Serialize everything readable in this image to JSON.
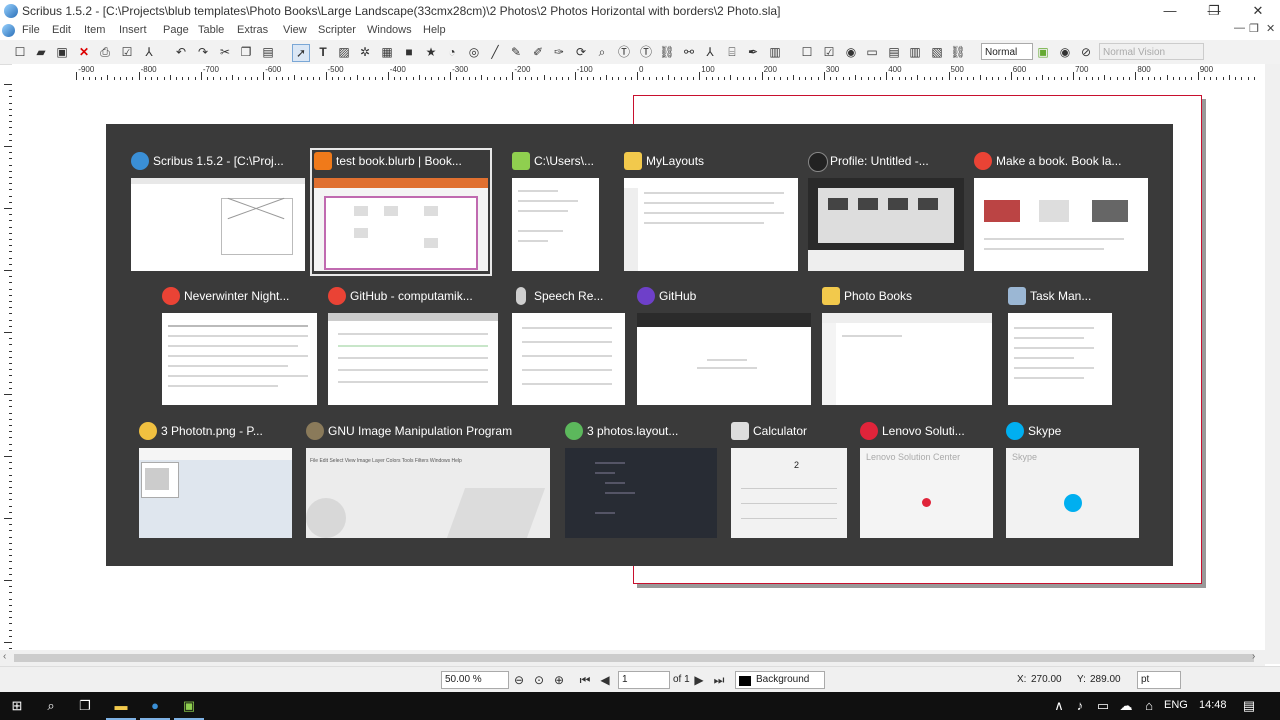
{
  "window": {
    "title": "Scribus 1.5.2 - [C:\\Projects\\blub templates\\Photo Books\\Large Landscape(33cmx28cm)\\2 Photos\\2 Photos Horizontal with borders\\2 Photo.sla]",
    "controls": {
      "minimize": "—",
      "restore": "❐",
      "close": "✕"
    },
    "inner_controls": {
      "minimize": "—",
      "restore": "❐",
      "close": "✕"
    }
  },
  "menu": [
    "File",
    "Edit",
    "Item",
    "Insert",
    "Page",
    "Table",
    "Extras",
    "View",
    "Scripter",
    "Windows",
    "Help"
  ],
  "toolbar": {
    "mode_select": "Normal",
    "vision_select": "Normal Vision"
  },
  "ruler_labels": [
    "-900",
    "-800",
    "-700",
    "-600",
    "-500",
    "-400",
    "-300",
    "-200",
    "-100",
    "0",
    "100",
    "200",
    "300",
    "400",
    "500",
    "600",
    "700",
    "800",
    "900"
  ],
  "task_switcher": {
    "rows": [
      [
        {
          "label": "Scribus 1.5.2 - [C:\\Proj...",
          "icon": "scribus-icon",
          "color": "#3a8fd6"
        },
        {
          "label": "test book.blurb | Book...",
          "icon": "booksmart-icon",
          "color": "#f07a1a",
          "selected": true
        },
        {
          "label": "C:\\Users\\...",
          "icon": "notepadpp-icon",
          "color": "#8fcf4f"
        },
        {
          "label": "MyLayouts",
          "icon": "folder-icon",
          "color": "#f2c94c"
        },
        {
          "label": "Profile: Untitled -...",
          "icon": "obs-icon",
          "color": "#222222"
        },
        {
          "label": "Make a book. Book la...",
          "icon": "chrome-icon",
          "color": "#ea4335"
        }
      ],
      [
        {
          "label": "Neverwinter Night...",
          "icon": "chrome-icon",
          "color": "#ea4335"
        },
        {
          "label": "GitHub - computamik...",
          "icon": "chrome-icon",
          "color": "#ea4335"
        },
        {
          "label": "Speech Re...",
          "icon": "microphone-icon",
          "color": "#cfcfcf"
        },
        {
          "label": "GitHub",
          "icon": "github-icon",
          "color": "#6e40c9"
        },
        {
          "label": "Photo Books",
          "icon": "folder-icon",
          "color": "#f2c94c"
        },
        {
          "label": "Task Man...",
          "icon": "task-manager-icon",
          "color": "#9bb7d4"
        }
      ],
      [
        {
          "label": "3 Phototn.png - P...",
          "icon": "paint-icon",
          "color": "#f0c040"
        },
        {
          "label": "GNU Image Manipulation Program",
          "icon": "gimp-icon",
          "color": "#8a7a5a"
        },
        {
          "label": "3 photos.layout...",
          "icon": "atom-icon",
          "color": "#5cb85c"
        },
        {
          "label": "Calculator",
          "icon": "calculator-icon",
          "color": "#dddddd"
        },
        {
          "label": "Lenovo Soluti...",
          "icon": "lenovo-icon",
          "color": "#e0243a"
        },
        {
          "label": "Skype",
          "icon": "skype-icon",
          "color": "#00aff0"
        }
      ]
    ],
    "gimp_menu": "File  Edit  Select  View  Image  Layer  Colors  Tools  Filters  Windows  Help",
    "calculator_display": "2",
    "lenovo_title": "Lenovo Solution Center",
    "skype_title": "Skype"
  },
  "statusbar": {
    "zoom": "50.00 %",
    "page": "1",
    "of_pages": "of 1",
    "layer": "Background",
    "x_label": "X:",
    "x_value": "270.00",
    "y_label": "Y:",
    "y_value": "289.00",
    "unit": "pt"
  },
  "taskbar": {
    "language": "ENG",
    "time": "14:48"
  }
}
